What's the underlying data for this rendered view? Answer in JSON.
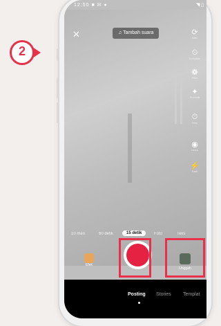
{
  "step": {
    "number": "2"
  },
  "status": {
    "left": "12:50 ■ ✉ ●",
    "right": "◥ ▯"
  },
  "top": {
    "close": "✕",
    "add_sound": "♫ Tambah suara"
  },
  "tools": [
    {
      "icon": "⟳",
      "label": "Balik"
    },
    {
      "icon": "⏲",
      "label": "Kecepatan"
    },
    {
      "icon": "❁",
      "label": "Filter"
    },
    {
      "icon": "✦",
      "label": "Percantik"
    },
    {
      "icon": "⏱",
      "label": "Timer"
    },
    {
      "icon": "◉",
      "label": "Lensa"
    },
    {
      "icon": "⚡",
      "label": "Flash"
    }
  ],
  "modes": {
    "m1": "10 men",
    "m2": "60 detik",
    "m3": "15 detik",
    "m4": "Foto",
    "m5": "Teks"
  },
  "effects": {
    "label": "Efek"
  },
  "upload": {
    "label": "Unggah"
  },
  "tabs": {
    "posting": "Posting",
    "stories": "Stories",
    "templat": "Templat"
  }
}
